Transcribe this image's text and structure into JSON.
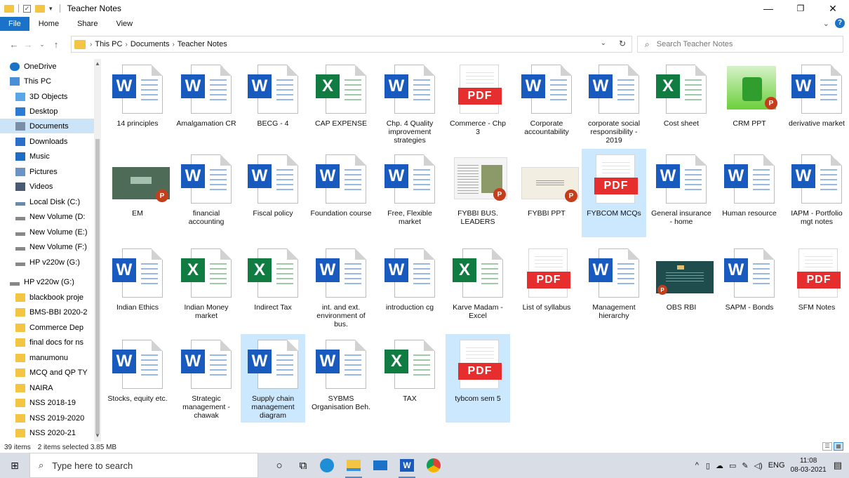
{
  "window": {
    "title": "Teacher Notes",
    "minimize": "—",
    "maximize": "❐",
    "close": "✕"
  },
  "ribbon": {
    "tabs": [
      "File",
      "Home",
      "Share",
      "View"
    ]
  },
  "address": {
    "crumbs": [
      "This PC",
      "Documents",
      "Teacher Notes"
    ],
    "search_placeholder": "Search Teacher Notes"
  },
  "nav": {
    "items": [
      {
        "label": "OneDrive",
        "icon": "cloud-icon",
        "color": "#1a73c9"
      },
      {
        "label": "This PC",
        "icon": "computer-icon",
        "color": "#4a90d9"
      },
      {
        "label": "3D Objects",
        "icon": "cube-icon",
        "color": "#5aa6e6"
      },
      {
        "label": "Desktop",
        "icon": "desktop-icon",
        "color": "#2b7bd4"
      },
      {
        "label": "Documents",
        "icon": "documents-icon",
        "color": "#7a8ea8"
      },
      {
        "label": "Downloads",
        "icon": "download-icon",
        "color": "#2a6fc9"
      },
      {
        "label": "Music",
        "icon": "music-icon",
        "color": "#1f6dc2"
      },
      {
        "label": "Pictures",
        "icon": "pictures-icon",
        "color": "#6b93c4"
      },
      {
        "label": "Videos",
        "icon": "videos-icon",
        "color": "#4a5a70"
      },
      {
        "label": "Local Disk (C:)",
        "icon": "disk-icon",
        "color": "#6b8aa8"
      },
      {
        "label": "New Volume (D:",
        "icon": "drive-icon",
        "color": "#888888"
      },
      {
        "label": "New Volume (E:)",
        "icon": "drive-icon",
        "color": "#888888"
      },
      {
        "label": "New Volume (F:)",
        "icon": "drive-icon",
        "color": "#888888"
      },
      {
        "label": "HP v220w (G:)",
        "icon": "drive-icon",
        "color": "#888888"
      },
      {
        "label": "HP v220w (G:)",
        "icon": "drive-icon",
        "color": "#888888"
      },
      {
        "label": "blackbook proje",
        "icon": "folder-icon",
        "color": "#f4c542"
      },
      {
        "label": "BMS-BBI 2020-2",
        "icon": "folder-icon",
        "color": "#f4c542"
      },
      {
        "label": "Commerce Dep",
        "icon": "folder-icon",
        "color": "#f4c542"
      },
      {
        "label": "final docs for ns",
        "icon": "folder-icon",
        "color": "#f4c542"
      },
      {
        "label": "manumonu",
        "icon": "folder-icon",
        "color": "#f4c542"
      },
      {
        "label": "MCQ and QP TY",
        "icon": "folder-icon",
        "color": "#f4c542"
      },
      {
        "label": "NAIRA",
        "icon": "folder-icon",
        "color": "#f4c542"
      },
      {
        "label": "NSS 2018-19",
        "icon": "folder-icon",
        "color": "#f4c542"
      },
      {
        "label": "NSS 2019-2020",
        "icon": "folder-icon",
        "color": "#f4c542"
      },
      {
        "label": "NSS 2020-21",
        "icon": "folder-icon",
        "color": "#f4c542"
      }
    ]
  },
  "files": [
    {
      "label": "14 principles",
      "type": "word"
    },
    {
      "label": "Amalgamation CR",
      "type": "word"
    },
    {
      "label": "BECG - 4",
      "type": "word"
    },
    {
      "label": "CAP EXPENSE",
      "type": "excel"
    },
    {
      "label": "Chp. 4 Quality improvement strategies",
      "type": "word"
    },
    {
      "label": "Commerce - Chp 3",
      "type": "pdf"
    },
    {
      "label": "Corporate accountability",
      "type": "word"
    },
    {
      "label": "corporate social responsibility - 2019",
      "type": "word"
    },
    {
      "label": "Cost sheet",
      "type": "excel"
    },
    {
      "label": "CRM PPT",
      "type": "ppt-crm"
    },
    {
      "label": "derivative market",
      "type": "word"
    },
    {
      "label": "EM",
      "type": "ppt-em"
    },
    {
      "label": "financial accounting",
      "type": "word"
    },
    {
      "label": "Fiscal policy",
      "type": "word"
    },
    {
      "label": "Foundation course",
      "type": "word"
    },
    {
      "label": "Free, Flexible market",
      "type": "word"
    },
    {
      "label": "FYBBI BUS. LEADERS",
      "type": "ppt-leaders"
    },
    {
      "label": "FYBBI PPT",
      "type": "ppt-fybbi"
    },
    {
      "label": "FYBCOM MCQs",
      "type": "pdf",
      "selected": true
    },
    {
      "label": "General insurance - home",
      "type": "word"
    },
    {
      "label": "Human resource",
      "type": "word"
    },
    {
      "label": "IAPM - Portfolio mgt notes",
      "type": "word"
    },
    {
      "label": "Indian Ethics",
      "type": "word"
    },
    {
      "label": "Indian Money market",
      "type": "excel"
    },
    {
      "label": "Indirect Tax",
      "type": "excel"
    },
    {
      "label": "int. and ext. environment of bus.",
      "type": "word"
    },
    {
      "label": "introduction cg",
      "type": "word"
    },
    {
      "label": "Karve Madam -Excel",
      "type": "excel"
    },
    {
      "label": "List of syllabus",
      "type": "pdf"
    },
    {
      "label": "Management hierarchy",
      "type": "word"
    },
    {
      "label": "OBS RBI",
      "type": "ppt-obs"
    },
    {
      "label": "SAPM - Bonds",
      "type": "word"
    },
    {
      "label": "SFM Notes",
      "type": "pdf"
    },
    {
      "label": "Stocks, equity etc.",
      "type": "word"
    },
    {
      "label": "Strategic management - chawak",
      "type": "word"
    },
    {
      "label": "Supply chain management diagram",
      "type": "word",
      "hover": true
    },
    {
      "label": "SYBMS Organisation Beh.",
      "type": "word"
    },
    {
      "label": "TAX",
      "type": "excel"
    },
    {
      "label": "tybcom sem 5",
      "type": "pdf",
      "selected": true
    }
  ],
  "status": {
    "count": "39 items",
    "selection": "2 items selected  3.85 MB"
  },
  "taskbar": {
    "search_placeholder": "Type here to search",
    "lang": "ENG",
    "time": "11:08",
    "date": "08-03-2021"
  },
  "colors": {
    "accent": "#1a73c9",
    "word": "#185abd",
    "excel": "#107c41",
    "pdf": "#e62e2e",
    "selected": "#cce8ff"
  }
}
